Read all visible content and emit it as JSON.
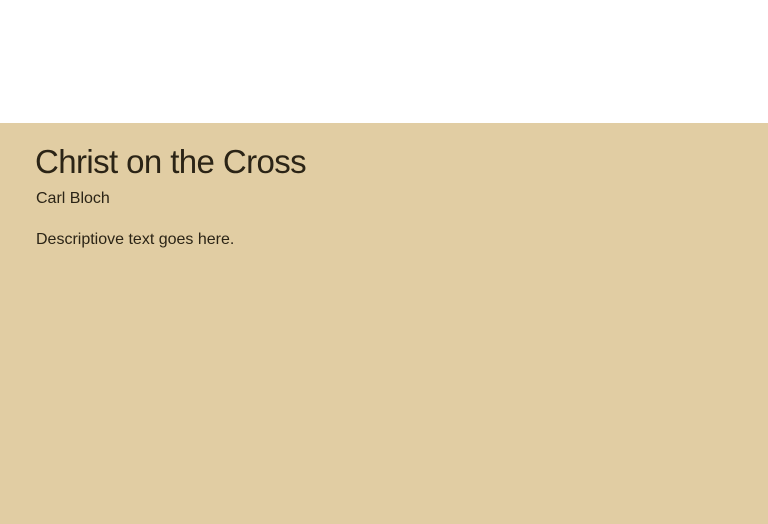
{
  "artwork": {
    "title": "Christ on the Cross",
    "artist": "Carl Bloch",
    "description": "Descriptiove text goes here."
  },
  "colors": {
    "top_background": "#ffffff",
    "panel_background": "#e1cda3",
    "text": "#2b2416"
  }
}
